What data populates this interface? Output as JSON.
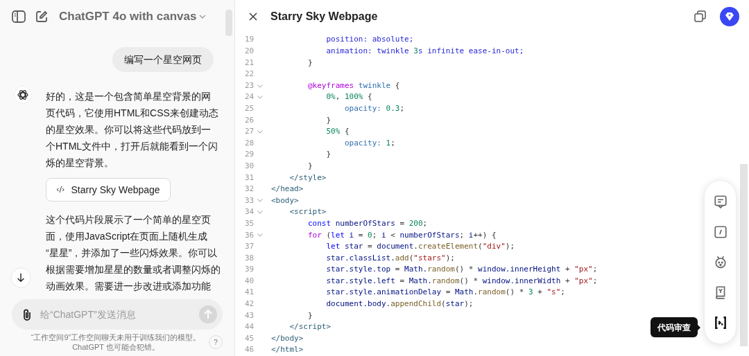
{
  "chat": {
    "model_title": "ChatGPT 4o with canvas",
    "user_message": "编写一个星空网页",
    "assistant_intro": [
      "好的，这是一个包含简单星空背景的网",
      "页代码，它使用HTML和CSS来创建动态",
      "的星空效果。你可以将这些代码放到一",
      "个HTML文件中，打开后就能看到一个闪",
      "烁的星空背景。"
    ],
    "canvas_chip": {
      "icon": "‹/›",
      "label": "Starry Sky Webpage"
    },
    "assistant_followup": [
      "这个代码片段展示了一个简单的星空页",
      "面，使用JavaScript在页面上随机生成",
      "“星星”，并添加了一些闪烁效果。你可以",
      "根据需要增加星星的数量或者调整闪烁的",
      "动画效果。需要进一步改进或添加功能"
    ],
    "composer": {
      "placeholder": "给“ChatGPT”发送消息"
    },
    "disclaimer": "“工作空间9”工作空间聊天未用于训练我们的模型。ChatGPT 也可能会犯错。",
    "help": "?"
  },
  "canvas": {
    "title": "Starry Sky Webpage",
    "lines": [
      {
        "number": "19",
        "foldable": false,
        "tokens": [
          {
            "kind": "prop",
            "text": "            position: absolute;"
          }
        ]
      },
      {
        "number": "20",
        "foldable": false,
        "tokens": [
          {
            "kind": "prop",
            "text": "            animation: twinkle "
          },
          {
            "kind": "num",
            "text": "3"
          },
          {
            "kind": "prop",
            "text": "s infinite ease-in-out;"
          }
        ]
      },
      {
        "number": "21",
        "foldable": false,
        "tokens": [
          {
            "kind": "plain",
            "text": "        }"
          }
        ]
      },
      {
        "number": "22",
        "foldable": false
      },
      {
        "number": "23",
        "foldable": true,
        "tokens": [
          {
            "kind": "control",
            "text": "        @keyframes"
          },
          {
            "kind": "attr",
            "text": " twinkle"
          },
          {
            "kind": "plain",
            "text": " {"
          }
        ]
      },
      {
        "number": "24",
        "foldable": true,
        "tokens": [
          {
            "kind": "num",
            "text": "            0%"
          },
          {
            "kind": "plain",
            "text": ", "
          },
          {
            "kind": "num",
            "text": "100%"
          },
          {
            "kind": "plain",
            "text": " {"
          }
        ]
      },
      {
        "number": "25",
        "foldable": false,
        "tokens": [
          {
            "kind": "attr",
            "text": "                opacity: "
          },
          {
            "kind": "num",
            "text": "0.3"
          },
          {
            "kind": "plain",
            "text": ";"
          }
        ]
      },
      {
        "number": "26",
        "foldable": false,
        "tokens": [
          {
            "kind": "plain",
            "text": "            }"
          }
        ]
      },
      {
        "number": "27",
        "foldable": true,
        "tokens": [
          {
            "kind": "num",
            "text": "            50%"
          },
          {
            "kind": "plain",
            "text": " {"
          }
        ]
      },
      {
        "number": "28",
        "foldable": false,
        "tokens": [
          {
            "kind": "attr",
            "text": "                opacity: "
          },
          {
            "kind": "num",
            "text": "1"
          },
          {
            "kind": "plain",
            "text": ";"
          }
        ]
      },
      {
        "number": "29",
        "foldable": false,
        "tokens": [
          {
            "kind": "plain",
            "text": "            }"
          }
        ]
      },
      {
        "number": "30",
        "foldable": false,
        "tokens": [
          {
            "kind": "plain",
            "text": "        }"
          }
        ]
      },
      {
        "number": "31",
        "foldable": false,
        "tokens": [
          {
            "kind": "tag",
            "text": "    </style>"
          }
        ]
      },
      {
        "number": "32",
        "foldable": false,
        "tokens": [
          {
            "kind": "tag",
            "text": "</head>"
          }
        ]
      },
      {
        "number": "33",
        "foldable": true,
        "tokens": [
          {
            "kind": "tag",
            "text": "<body>"
          }
        ]
      },
      {
        "number": "34",
        "foldable": true,
        "tokens": [
          {
            "kind": "tag",
            "text": "    <script>"
          }
        ]
      },
      {
        "number": "35",
        "foldable": false,
        "tokens": [
          {
            "kind": "keyword",
            "text": "        const"
          },
          {
            "kind": "var",
            "text": " numberOfStars"
          },
          {
            "kind": "plain",
            "text": " = "
          },
          {
            "kind": "num",
            "text": "200"
          },
          {
            "kind": "plain",
            "text": ";"
          }
        ]
      },
      {
        "number": "36",
        "foldable": true,
        "tokens": [
          {
            "kind": "control",
            "text": "        for"
          },
          {
            "kind": "plain",
            "text": " ("
          },
          {
            "kind": "keyword",
            "text": "let"
          },
          {
            "kind": "var",
            "text": " i"
          },
          {
            "kind": "plain",
            "text": " = "
          },
          {
            "kind": "num",
            "text": "0"
          },
          {
            "kind": "plain",
            "text": "; "
          },
          {
            "kind": "var",
            "text": "i"
          },
          {
            "kind": "plain",
            "text": " < "
          },
          {
            "kind": "var",
            "text": "numberOfStars"
          },
          {
            "kind": "plain",
            "text": "; "
          },
          {
            "kind": "var",
            "text": "i"
          },
          {
            "kind": "plain",
            "text": "++) {"
          }
        ]
      },
      {
        "number": "37",
        "foldable": false,
        "tokens": [
          {
            "kind": "keyword",
            "text": "            let"
          },
          {
            "kind": "var",
            "text": " star"
          },
          {
            "kind": "plain",
            "text": " = "
          },
          {
            "kind": "var",
            "text": "document"
          },
          {
            "kind": "plain",
            "text": "."
          },
          {
            "kind": "func",
            "text": "createElement"
          },
          {
            "kind": "plain",
            "text": "("
          },
          {
            "kind": "string",
            "text": "\"div\""
          },
          {
            "kind": "plain",
            "text": ");"
          }
        ]
      },
      {
        "number": "38",
        "foldable": false,
        "tokens": [
          {
            "kind": "var",
            "text": "            star.classList."
          },
          {
            "kind": "func",
            "text": "add"
          },
          {
            "kind": "plain",
            "text": "("
          },
          {
            "kind": "string",
            "text": "\"stars\""
          },
          {
            "kind": "plain",
            "text": ");"
          }
        ]
      },
      {
        "number": "39",
        "foldable": false,
        "tokens": [
          {
            "kind": "var",
            "text": "            star.style.top"
          },
          {
            "kind": "plain",
            "text": " = "
          },
          {
            "kind": "var",
            "text": "Math."
          },
          {
            "kind": "func",
            "text": "random"
          },
          {
            "kind": "plain",
            "text": "() * "
          },
          {
            "kind": "var",
            "text": "window.innerHeight"
          },
          {
            "kind": "plain",
            "text": " + "
          },
          {
            "kind": "string",
            "text": "\"px\""
          },
          {
            "kind": "plain",
            "text": ";"
          }
        ]
      },
      {
        "number": "40",
        "foldable": false,
        "tokens": [
          {
            "kind": "var",
            "text": "            star.style.left"
          },
          {
            "kind": "plain",
            "text": " = "
          },
          {
            "kind": "var",
            "text": "Math."
          },
          {
            "kind": "func",
            "text": "random"
          },
          {
            "kind": "plain",
            "text": "() * "
          },
          {
            "kind": "var",
            "text": "window.innerWidth"
          },
          {
            "kind": "plain",
            "text": " + "
          },
          {
            "kind": "string",
            "text": "\"px\""
          },
          {
            "kind": "plain",
            "text": ";"
          }
        ]
      },
      {
        "number": "41",
        "foldable": false,
        "tokens": [
          {
            "kind": "var",
            "text": "            star.style.animationDelay"
          },
          {
            "kind": "plain",
            "text": " = "
          },
          {
            "kind": "var",
            "text": "Math."
          },
          {
            "kind": "func",
            "text": "random"
          },
          {
            "kind": "plain",
            "text": "() * "
          },
          {
            "kind": "num",
            "text": "3"
          },
          {
            "kind": "plain",
            "text": " + "
          },
          {
            "kind": "string",
            "text": "\"s\""
          },
          {
            "kind": "plain",
            "text": ";"
          }
        ]
      },
      {
        "number": "42",
        "foldable": false,
        "tokens": [
          {
            "kind": "var",
            "text": "            document.body."
          },
          {
            "kind": "func",
            "text": "appendChild"
          },
          {
            "kind": "plain",
            "text": "("
          },
          {
            "kind": "var",
            "text": "star"
          },
          {
            "kind": "plain",
            "text": ");"
          }
        ]
      },
      {
        "number": "43",
        "foldable": false,
        "tokens": [
          {
            "kind": "plain",
            "text": "        }"
          }
        ]
      },
      {
        "number": "44",
        "foldable": false,
        "tokens": [
          {
            "kind": "tag",
            "text": "    </script>"
          }
        ]
      },
      {
        "number": "45",
        "foldable": false,
        "tokens": [
          {
            "kind": "tag",
            "text": "</body>"
          }
        ]
      },
      {
        "number": "46",
        "foldable": false,
        "tokens": [
          {
            "kind": "tag",
            "text": "</html>"
          }
        ]
      }
    ],
    "tools": [
      {
        "kind": "comment",
        "selected": false
      },
      {
        "kind": "edit",
        "selected": false
      },
      {
        "kind": "bug",
        "selected": false
      },
      {
        "kind": "book",
        "selected": false
      },
      {
        "kind": "review",
        "selected": true
      }
    ],
    "tooltip": "代码审查"
  }
}
